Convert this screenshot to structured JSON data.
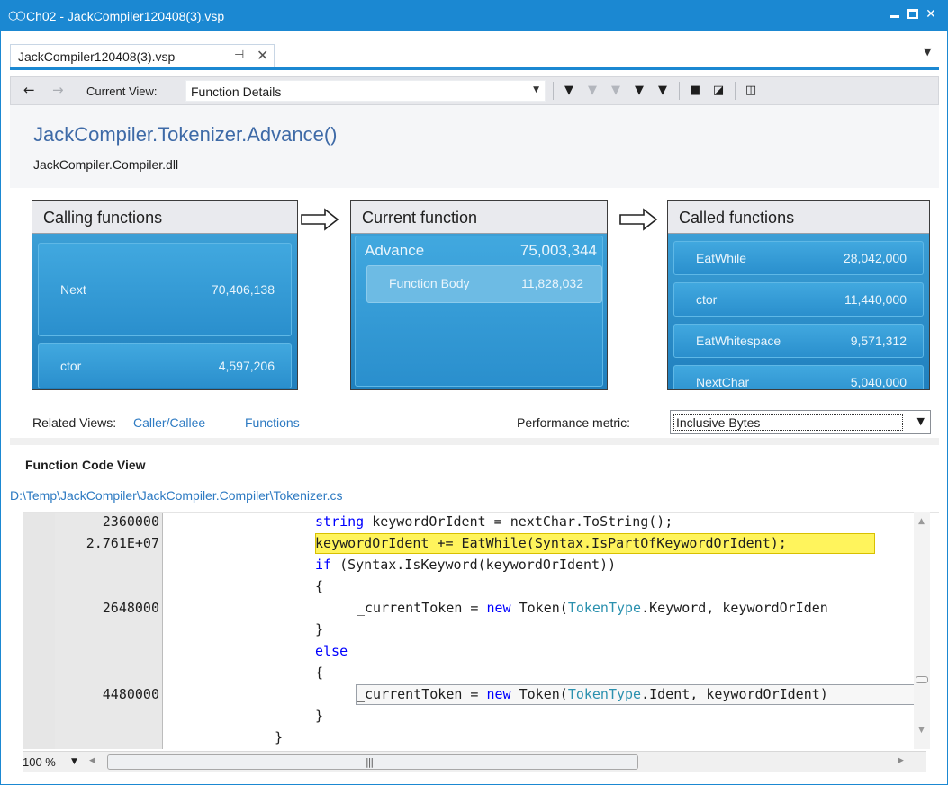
{
  "window": {
    "title": "Ch02 - JackCompiler120408(3).vsp",
    "accent_color": "#1b88d2"
  },
  "tab": {
    "label": "JackCompiler120408(3).vsp"
  },
  "toolbar": {
    "current_view_label": "Current View:",
    "current_view_value": "Function Details",
    "icons": [
      "filter-icon",
      "clear-filter-icon",
      "filter-disabled-icon",
      "filter-add-icon",
      "filter-settings-icon",
      "save-icon",
      "export-icon",
      "split-view-icon"
    ]
  },
  "header": {
    "function_name": "JackCompiler.Tokenizer.Advance()",
    "module": "JackCompiler.Compiler.dll"
  },
  "flow": {
    "calling": {
      "title": "Calling functions",
      "items": [
        {
          "name": "Next",
          "value": "70,406,138"
        },
        {
          "name": "ctor",
          "value": "4,597,206"
        }
      ]
    },
    "current": {
      "title": "Current function",
      "name": "Advance",
      "value": "75,003,344",
      "body_name": "Function Body",
      "body_value": "11,828,032"
    },
    "called": {
      "title": "Called functions",
      "items": [
        {
          "name": "EatWhile",
          "value": "28,042,000"
        },
        {
          "name": "ctor",
          "value": "11,440,000"
        },
        {
          "name": "EatWhitespace",
          "value": "9,571,312"
        },
        {
          "name": "NextChar",
          "value": "5,040,000"
        }
      ]
    }
  },
  "related": {
    "label": "Related Views:",
    "links": [
      "Caller/Callee",
      "Functions"
    ],
    "metric_label": "Performance metric:",
    "metric_value": "Inclusive Bytes"
  },
  "code": {
    "title": "Function Code View",
    "path": "D:\\Temp\\JackCompiler\\JackCompiler.Compiler\\Tokenizer.cs",
    "lines": [
      {
        "value": "2360000",
        "code": "string keywordOrIdent = nextChar.ToString();"
      },
      {
        "value": "2.761E+07",
        "code": "keywordOrIdent += EatWhile(Syntax.IsPartOfKeywordOrIdent);"
      },
      {
        "value": "",
        "code": "if (Syntax.IsKeyword(keywordOrIdent))"
      },
      {
        "value": "",
        "code": "{"
      },
      {
        "value": "2648000",
        "code": "_currentToken = new Token(TokenType.Keyword, keywordOrIden"
      },
      {
        "value": "",
        "code": "}"
      },
      {
        "value": "",
        "code": "else"
      },
      {
        "value": "",
        "code": "{"
      },
      {
        "value": "4480000",
        "code": "_currentToken = new Token(TokenType.Ident, keywordOrIdent)"
      },
      {
        "value": "",
        "code": "}"
      },
      {
        "value": "",
        "code": "}"
      }
    ],
    "keywords": [
      "string",
      "if",
      "else",
      "new"
    ],
    "types": [
      "TokenType"
    ]
  },
  "status": {
    "zoom": "100 %"
  }
}
